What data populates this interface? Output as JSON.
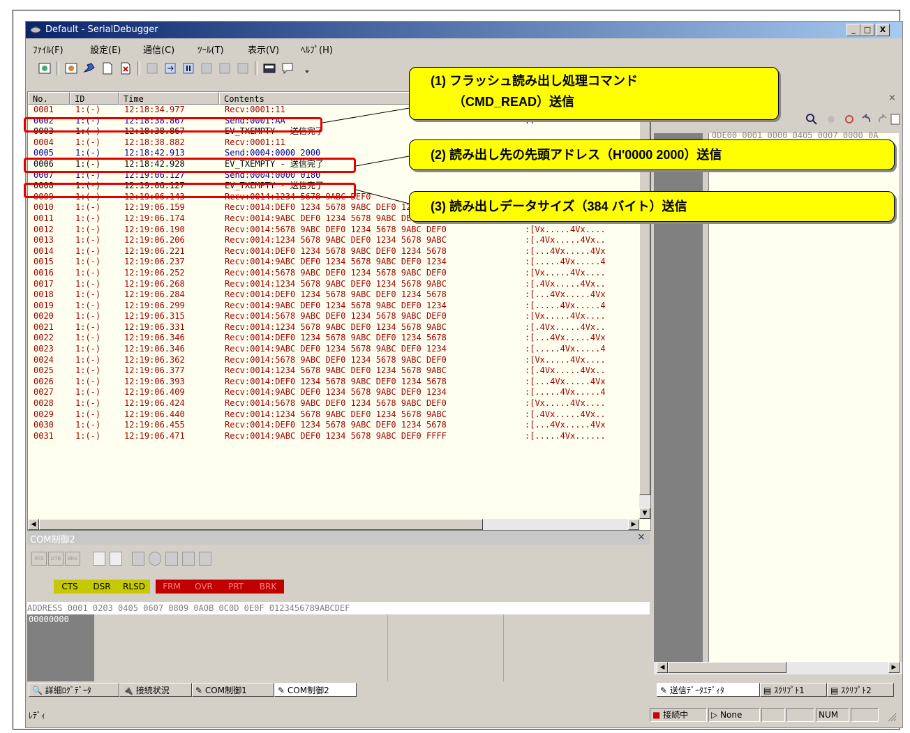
{
  "window": {
    "title": "Default - SerialDebugger",
    "controls": [
      "_",
      "□",
      "X"
    ]
  },
  "menu": [
    "ﾌｧｲﾙ(F)",
    "設定(E)",
    "通信(C)",
    "ﾂｰﾙ(T)",
    "表示(V)",
    "ﾍﾙﾌﾟ(H)"
  ],
  "log": {
    "headers": [
      "No.",
      "ID",
      "Time",
      "Contents"
    ],
    "rows": [
      {
        "no": "0001",
        "id": "1:(-)",
        "time": "12:18:34.977",
        "contents": "Recv:0001:11",
        "ascii": "",
        "kind": "recv"
      },
      {
        "no": "0002",
        "id": "1:(-)",
        "time": "12:18:38.867",
        "contents": "Send:0001:AA",
        "ascii": ":.",
        "kind": "send"
      },
      {
        "no": "0003",
        "id": "1:(-)",
        "time": "12:18:38.867",
        "contents": "EV_TXEMPTY - 送信完了",
        "ascii": "",
        "kind": "ev"
      },
      {
        "no": "0004",
        "id": "1:(-)",
        "time": "12:18:38.882",
        "contents": "Recv:0001:11",
        "ascii": "",
        "kind": "recv"
      },
      {
        "no": "0005",
        "id": "1:(-)",
        "time": "12:18:42.913",
        "contents": "Send:0004:0000 2000",
        "ascii": "",
        "kind": "send"
      },
      {
        "no": "0006",
        "id": "1:(-)",
        "time": "12:18:42.928",
        "contents": "EV_TXEMPTY - 送信完了",
        "ascii": "",
        "kind": "ev"
      },
      {
        "no": "0007",
        "id": "1:(-)",
        "time": "12:19:06.127",
        "contents": "Send:0004:0000 0180",
        "ascii": "",
        "kind": "send"
      },
      {
        "no": "0008",
        "id": "1:(-)",
        "time": "12:19:06.127",
        "contents": "EV_TXEMPTY - 送信完了",
        "ascii": "",
        "kind": "ev"
      },
      {
        "no": "0009",
        "id": "1:(-)",
        "time": "12:19:06.143",
        "contents": "Recv:0014:1234 5678 9ABC DEF0",
        "ascii": "",
        "kind": "recv"
      },
      {
        "no": "0010",
        "id": "1:(-)",
        "time": "12:19:06.159",
        "contents": "Recv:0014:DEF0 1234 5678 9ABC DEF0 1234 5678",
        "ascii": ":[...4Vx.....4Vx",
        "kind": "recv"
      },
      {
        "no": "0011",
        "id": "1:(-)",
        "time": "12:19:06.174",
        "contents": "Recv:0014:9ABC DEF0 1234 5678 9ABC DEF0 1234",
        "ascii": ":[.....4Vx.....4",
        "kind": "recv"
      },
      {
        "no": "0012",
        "id": "1:(-)",
        "time": "12:19:06.190",
        "contents": "Recv:0014:5678 9ABC DEF0 1234 5678 9ABC DEF0",
        "ascii": ":[Vx.....4Vx....",
        "kind": "recv"
      },
      {
        "no": "0013",
        "id": "1:(-)",
        "time": "12:19:06.206",
        "contents": "Recv:0014:1234 5678 9ABC DEF0 1234 5678 9ABC",
        "ascii": ":[.4Vx.....4Vx..",
        "kind": "recv"
      },
      {
        "no": "0014",
        "id": "1:(-)",
        "time": "12:19:06.221",
        "contents": "Recv:0014:DEF0 1234 5678 9ABC DEF0 1234 5678",
        "ascii": ":[...4Vx.....4Vx",
        "kind": "recv"
      },
      {
        "no": "0015",
        "id": "1:(-)",
        "time": "12:19:06.237",
        "contents": "Recv:0014:9ABC DEF0 1234 5678 9ABC DEF0 1234",
        "ascii": ":[.....4Vx.....4",
        "kind": "recv"
      },
      {
        "no": "0016",
        "id": "1:(-)",
        "time": "12:19:06.252",
        "contents": "Recv:0014:5678 9ABC DEF0 1234 5678 9ABC DEF0",
        "ascii": ":[Vx.....4Vx....",
        "kind": "recv"
      },
      {
        "no": "0017",
        "id": "1:(-)",
        "time": "12:19:06.268",
        "contents": "Recv:0014:1234 5678 9ABC DEF0 1234 5678 9ABC",
        "ascii": ":[.4Vx.....4Vx..",
        "kind": "recv"
      },
      {
        "no": "0018",
        "id": "1:(-)",
        "time": "12:19:06.284",
        "contents": "Recv:0014:DEF0 1234 5678 9ABC DEF0 1234 5678",
        "ascii": ":[...4Vx.....4Vx",
        "kind": "recv"
      },
      {
        "no": "0019",
        "id": "1:(-)",
        "time": "12:19:06.299",
        "contents": "Recv:0014:9ABC DEF0 1234 5678 9ABC DEF0 1234",
        "ascii": ":[.....4Vx.....4",
        "kind": "recv"
      },
      {
        "no": "0020",
        "id": "1:(-)",
        "time": "12:19:06.315",
        "contents": "Recv:0014:5678 9ABC DEF0 1234 5678 9ABC DEF0",
        "ascii": ":[Vx.....4Vx....",
        "kind": "recv"
      },
      {
        "no": "0021",
        "id": "1:(-)",
        "time": "12:19:06.331",
        "contents": "Recv:0014:1234 5678 9ABC DEF0 1234 5678 9ABC",
        "ascii": ":[.4Vx.....4Vx..",
        "kind": "recv"
      },
      {
        "no": "0022",
        "id": "1:(-)",
        "time": "12:19:06.346",
        "contents": "Recv:0014:DEF0 1234 5678 9ABC DEF0 1234 5678",
        "ascii": ":[...4Vx.....4Vx",
        "kind": "recv"
      },
      {
        "no": "0023",
        "id": "1:(-)",
        "time": "12:19:06.346",
        "contents": "Recv:0014:9ABC DEF0 1234 5678 9ABC DEF0 1234",
        "ascii": ":[.....4Vx.....4",
        "kind": "recv"
      },
      {
        "no": "0024",
        "id": "1:(-)",
        "time": "12:19:06.362",
        "contents": "Recv:0014:5678 9ABC DEF0 1234 5678 9ABC DEF0",
        "ascii": ":[Vx.....4Vx....",
        "kind": "recv"
      },
      {
        "no": "0025",
        "id": "1:(-)",
        "time": "12:19:06.377",
        "contents": "Recv:0014:1234 5678 9ABC DEF0 1234 5678 9ABC",
        "ascii": ":[.4Vx.....4Vx..",
        "kind": "recv"
      },
      {
        "no": "0026",
        "id": "1:(-)",
        "time": "12:19:06.393",
        "contents": "Recv:0014:DEF0 1234 5678 9ABC DEF0 1234 5678",
        "ascii": ":[...4Vx.....4Vx",
        "kind": "recv"
      },
      {
        "no": "0027",
        "id": "1:(-)",
        "time": "12:19:06.409",
        "contents": "Recv:0014:9ABC DEF0 1234 5678 9ABC DEF0 1234",
        "ascii": ":[.....4Vx.....4",
        "kind": "recv"
      },
      {
        "no": "0028",
        "id": "1:(-)",
        "time": "12:19:06.424",
        "contents": "Recv:0014:5678 9ABC DEF0 1234 5678 9ABC DEF0",
        "ascii": ":[Vx.....4Vx....",
        "kind": "recv"
      },
      {
        "no": "0029",
        "id": "1:(-)",
        "time": "12:19:06.440",
        "contents": "Recv:0014:1234 5678 9ABC DEF0 1234 5678 9ABC",
        "ascii": ":[.4Vx.....4Vx..",
        "kind": "recv"
      },
      {
        "no": "0030",
        "id": "1:(-)",
        "time": "12:19:06.455",
        "contents": "Recv:0014:DEF0 1234 5678 9ABC DEF0 1234 5678",
        "ascii": ":[...4Vx.....4Vx",
        "kind": "recv"
      },
      {
        "no": "0031",
        "id": "1:(-)",
        "time": "12:19:06.471",
        "contents": "Recv:0014:9ABC DEF0 1234 5678 9ABC DEF0 FFFF",
        "ascii": ":[.....4Vx......",
        "kind": "recv"
      }
    ]
  },
  "right_pane": {
    "hex_partial": "0DE00  0001 0000 0405 0007 0000 0A"
  },
  "com": {
    "title": "COM制御2",
    "signals": [
      {
        "label": "CTS",
        "color": "#c8c800"
      },
      {
        "label": "DSR",
        "color": "#c8c800"
      },
      {
        "label": "RLSD",
        "color": "#c8c800"
      },
      {
        "label": "FRM",
        "color": "#c00000"
      },
      {
        "label": "OVR",
        "color": "#c00000"
      },
      {
        "label": "PRT",
        "color": "#c00000"
      },
      {
        "label": "BRK",
        "color": "#c00000"
      }
    ],
    "address_header": "ADDRESS   0001 0203 0405 0607 0809 0A0B 0C0D 0E0F   0123456789ABCDEF",
    "address_row": "00000000"
  },
  "tabs_left": [
    "詳細ﾛｸﾞﾃﾞｰﾀ",
    "接続状況",
    "COM制御1",
    "COM制御2"
  ],
  "tabs_right": [
    "送信ﾃﾞｰﾀｴﾃﾞｨﾀ",
    "ｽｸﾘﾌﾟﾄ1",
    "ｽｸﾘﾌﾟﾄ2"
  ],
  "status": {
    "ready": "ﾚﾃﾞｨ",
    "connected": "接続中",
    "none": "None",
    "num": "NUM"
  },
  "callouts": [
    {
      "line1": "(1)  フラッシュ読み出し処理コマンド",
      "line2": "（CMD_READ）送信"
    },
    {
      "line1": "(2)  読み出し先の先頭アドレス（H'0000 2000）送信"
    },
    {
      "line1": "(3)  読み出しデータサイズ（384 バイト）送信"
    }
  ],
  "colors": {
    "recv": "#a00000",
    "send": "#0000a8",
    "callout": "#ffff00",
    "highlight": "#e00000"
  }
}
